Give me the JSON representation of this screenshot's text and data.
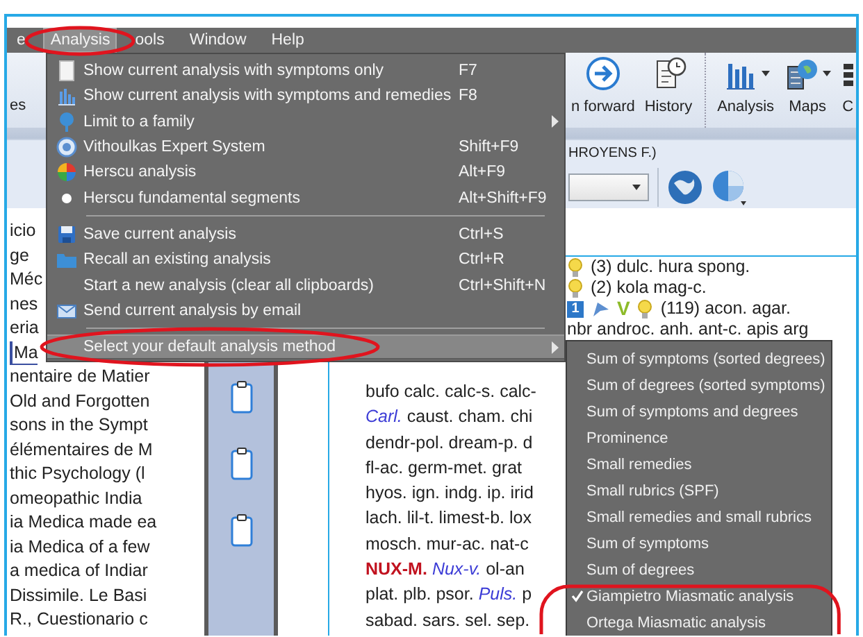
{
  "menu_bar": [
    {
      "label": "e",
      "selected": false,
      "circled": false
    },
    {
      "label": "Analysis",
      "selected": true,
      "circled": true
    },
    {
      "label": "ools",
      "selected": false,
      "circled": false
    },
    {
      "label": "Window",
      "selected": false,
      "circled": false
    },
    {
      "label": "Help",
      "selected": false,
      "circled": false
    }
  ],
  "toolbar": {
    "left_button": {
      "label": "es"
    },
    "buttons": [
      {
        "label": "n forward",
        "dropdown": false,
        "separator_before": false
      },
      {
        "label": "History",
        "dropdown": false,
        "separator_before": false
      },
      {
        "label": "Analysis",
        "dropdown": true,
        "separator_before": true
      },
      {
        "label": "Maps",
        "dropdown": true,
        "separator_before": false
      },
      {
        "label": "C",
        "dropdown": false,
        "separator_before": false
      }
    ]
  },
  "filter_bar": {
    "source_label": "HROYENS F.)"
  },
  "sidebar": {
    "items": [
      {
        "label": "icio",
        "selected": false
      },
      {
        "label": "ge",
        "selected": false
      },
      {
        "label": "Méc",
        "selected": false
      },
      {
        "label": "nes",
        "selected": false
      },
      {
        "label": "eria",
        "selected": false
      },
      {
        "label": "Ma",
        "selected": true
      },
      {
        "label": "nentaire de Matier",
        "selected": false
      },
      {
        "label": "Old and Forgotten",
        "selected": false
      },
      {
        "label": "sons in the Sympt",
        "selected": false
      },
      {
        "label": "élémentaires de M",
        "selected": false
      },
      {
        "label": "thic Psychology (l",
        "selected": false
      },
      {
        "label": "omeopathic India",
        "selected": false
      },
      {
        "label": "ia Medica made ea",
        "selected": false
      },
      {
        "label": "ia Medica of a few",
        "selected": false
      },
      {
        "label": "a medica of Indiar",
        "selected": false
      },
      {
        "label": "Dissimile. Le Basi",
        "selected": false
      },
      {
        "label": "R., Cuestionario c",
        "selected": false
      }
    ]
  },
  "results": {
    "rubrics": [
      {
        "flagged": false,
        "bulb": true,
        "text": "(3) dulc. hura spong."
      },
      {
        "flagged": false,
        "bulb": true,
        "text": "(2) kola mag-c."
      },
      {
        "badge": "1",
        "flagged": true,
        "grade": "V",
        "bulb": true,
        "text": "(119) acon. agar."
      }
    ],
    "remedy_lines_top": [
      "nbr androc. anh. ant-c. apis arg"
    ],
    "remedy_lines": [
      "bufo calc. calc-s. calc-",
      "*Carl.* caust. cham. chi",
      "dendr-pol. dream-p. d",
      "fl-ac. germ-met. grat",
      "hyos. ign. indg. ip. irid",
      "lach. lil-t. limest-b. lox",
      "mosch. mur-ac. nat-c",
      "**NUX-M.** *Nux-v.* ol-an",
      "plat. plb. psor. *Puls.* p",
      "sabad. sars. sel. sep."
    ]
  },
  "menu": {
    "items": [
      {
        "kind": "item",
        "label": "Show current analysis with symptoms only",
        "shortcut": "F7",
        "submenu": false,
        "selected": false,
        "circled": false
      },
      {
        "kind": "item",
        "label": "Show current analysis with symptoms and remedies",
        "shortcut": "F8",
        "submenu": false,
        "selected": false,
        "circled": false
      },
      {
        "kind": "item",
        "label": "Limit to a family",
        "submenu": true,
        "selected": false,
        "circled": false
      },
      {
        "kind": "item",
        "label": "Vithoulkas Expert System",
        "shortcut": "Shift+F9",
        "submenu": false,
        "selected": false,
        "circled": false
      },
      {
        "kind": "item",
        "label": "Herscu analysis",
        "shortcut": "Alt+F9",
        "submenu": false,
        "selected": false,
        "circled": false
      },
      {
        "kind": "item",
        "label": "Herscu fundamental segments",
        "shortcut": "Alt+Shift+F9",
        "submenu": false,
        "selected": false,
        "circled": false
      },
      {
        "kind": "separator"
      },
      {
        "kind": "item",
        "label": "Save current analysis",
        "shortcut": "Ctrl+S",
        "submenu": false,
        "selected": false,
        "circled": false
      },
      {
        "kind": "item",
        "label": "Recall an existing analysis",
        "shortcut": "Ctrl+R",
        "submenu": false,
        "selected": false,
        "circled": false
      },
      {
        "kind": "item",
        "label": "Start a new analysis (clear all clipboards)",
        "shortcut": "Ctrl+Shift+N",
        "submenu": false,
        "selected": false,
        "circled": false
      },
      {
        "kind": "item",
        "label": "Send current analysis by email",
        "submenu": false,
        "selected": false,
        "circled": false
      },
      {
        "kind": "separator"
      },
      {
        "kind": "item",
        "label": "Select your default analysis method",
        "submenu": true,
        "selected": true,
        "circled": true
      }
    ]
  },
  "submenu": {
    "items": [
      {
        "label": "Sum of symptoms (sorted degrees)",
        "checked": false,
        "circled": false
      },
      {
        "label": "Sum of degrees (sorted symptoms)",
        "checked": false,
        "circled": false
      },
      {
        "label": "Sum of symptoms and degrees",
        "checked": false,
        "circled": false
      },
      {
        "label": "Prominence",
        "checked": false,
        "circled": false
      },
      {
        "label": "Small remedies",
        "checked": false,
        "circled": false
      },
      {
        "label": "Small rubrics (SPF)",
        "checked": false,
        "circled": false
      },
      {
        "label": "Small remedies and small rubrics",
        "checked": false,
        "circled": false
      },
      {
        "label": "Sum of symptoms",
        "checked": false,
        "circled": false
      },
      {
        "label": "Sum of degrees",
        "checked": false,
        "circled": false
      },
      {
        "label": "Giampietro Miasmatic analysis",
        "checked": true,
        "circled": true
      },
      {
        "label": "Ortega Miasmatic analysis",
        "checked": false,
        "circled": true
      }
    ]
  }
}
